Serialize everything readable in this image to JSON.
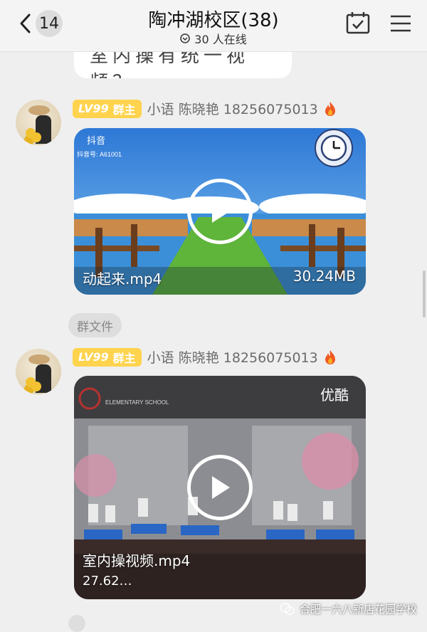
{
  "header": {
    "back_count": "14",
    "title": "陶冲湖校区(38)",
    "online": "30 人在线"
  },
  "previous_message": {
    "text": "室内操有统一视频？"
  },
  "messages": [
    {
      "level": "LV99",
      "role": "群主",
      "sender": "小语 陈晓艳 18256075013",
      "video": {
        "filename": "动起来.mp4",
        "size": "30.24MB",
        "source_label": "抖音",
        "source_id": "抖音号: A61001"
      }
    },
    {
      "level": "LV99",
      "role": "群主",
      "sender": "小语 陈晓艳 18256075013",
      "video": {
        "filename": "室内操视频.mp4",
        "size": "27.62…",
        "source_label": "优酷",
        "school_sub": "ELEMENTARY SCHOOL"
      }
    }
  ],
  "group_file_tag": "群文件",
  "watermark": "合肥一六八新店花园学校",
  "colors": {
    "level_badge": "#ffd34d",
    "tag_bg": "#dedede",
    "header_bg": "#f4f4f4"
  }
}
